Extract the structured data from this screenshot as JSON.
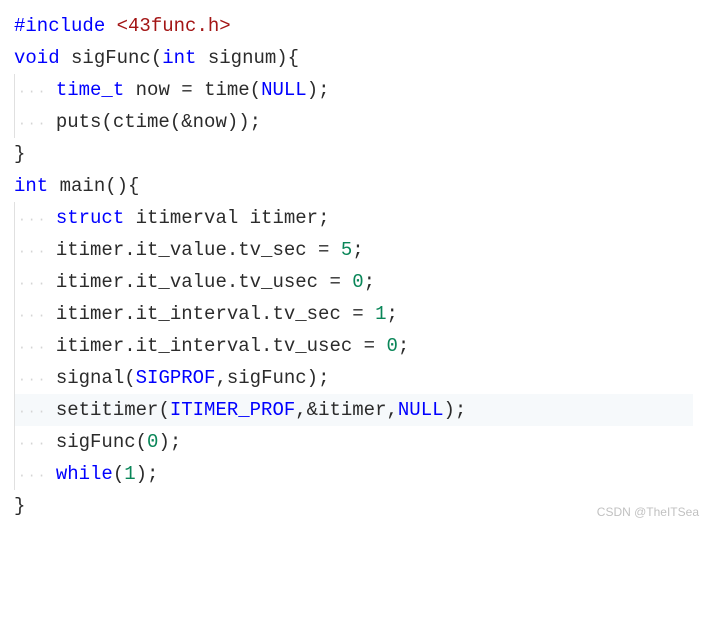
{
  "lines": [
    {
      "indent": 0,
      "tokens": [
        {
          "t": "#include ",
          "c": "pre"
        },
        {
          "t": "<43func.h>",
          "c": "inc"
        }
      ]
    },
    {
      "indent": 0,
      "tokens": [
        {
          "t": "void",
          "c": "kw"
        },
        {
          "t": " ",
          "c": "id"
        },
        {
          "t": "sigFunc",
          "c": "fn"
        },
        {
          "t": "(",
          "c": "op"
        },
        {
          "t": "int",
          "c": "kw"
        },
        {
          "t": " signum){",
          "c": "id"
        }
      ]
    },
    {
      "indent": 1,
      "tokens": [
        {
          "t": "time_t",
          "c": "type"
        },
        {
          "t": " now = ",
          "c": "id"
        },
        {
          "t": "time",
          "c": "fn"
        },
        {
          "t": "(",
          "c": "op"
        },
        {
          "t": "NULL",
          "c": "const"
        },
        {
          "t": ");",
          "c": "op"
        }
      ]
    },
    {
      "indent": 1,
      "tokens": [
        {
          "t": "puts",
          "c": "fn"
        },
        {
          "t": "(",
          "c": "op"
        },
        {
          "t": "ctime",
          "c": "fn"
        },
        {
          "t": "(&now));",
          "c": "op"
        }
      ]
    },
    {
      "indent": 0,
      "tokens": [
        {
          "t": "}",
          "c": "op"
        }
      ]
    },
    {
      "indent": 0,
      "tokens": [
        {
          "t": "int",
          "c": "kw"
        },
        {
          "t": " ",
          "c": "id"
        },
        {
          "t": "main",
          "c": "fn"
        },
        {
          "t": "(){",
          "c": "op"
        }
      ]
    },
    {
      "indent": 1,
      "tokens": [
        {
          "t": "struct",
          "c": "kw"
        },
        {
          "t": " itimerval itimer;",
          "c": "id"
        }
      ]
    },
    {
      "indent": 1,
      "tokens": [
        {
          "t": "itimer.it_value.tv_sec = ",
          "c": "id"
        },
        {
          "t": "5",
          "c": "num"
        },
        {
          "t": ";",
          "c": "op"
        }
      ]
    },
    {
      "indent": 1,
      "tokens": [
        {
          "t": "itimer.it_value.tv_usec = ",
          "c": "id"
        },
        {
          "t": "0",
          "c": "num"
        },
        {
          "t": ";",
          "c": "op"
        }
      ]
    },
    {
      "indent": 1,
      "tokens": [
        {
          "t": "itimer.it_interval.tv_sec = ",
          "c": "id"
        },
        {
          "t": "1",
          "c": "num"
        },
        {
          "t": ";",
          "c": "op"
        }
      ]
    },
    {
      "indent": 1,
      "tokens": [
        {
          "t": "itimer.it_interval.tv_usec = ",
          "c": "id"
        },
        {
          "t": "0",
          "c": "num"
        },
        {
          "t": ";",
          "c": "op"
        }
      ]
    },
    {
      "indent": 1,
      "tokens": [
        {
          "t": "signal",
          "c": "fn"
        },
        {
          "t": "(",
          "c": "op"
        },
        {
          "t": "SIGPROF",
          "c": "const"
        },
        {
          "t": ",sigFunc);",
          "c": "id"
        }
      ]
    },
    {
      "indent": 1,
      "highlight": true,
      "tokens": [
        {
          "t": "setitimer",
          "c": "fn"
        },
        {
          "t": "(",
          "c": "op"
        },
        {
          "t": "ITIMER_PROF",
          "c": "const"
        },
        {
          "t": ",&itimer,",
          "c": "id"
        },
        {
          "t": "NULL",
          "c": "const"
        },
        {
          "t": ");",
          "c": "op"
        }
      ]
    },
    {
      "indent": 1,
      "tokens": [
        {
          "t": "sigFunc",
          "c": "fn"
        },
        {
          "t": "(",
          "c": "op"
        },
        {
          "t": "0",
          "c": "num"
        },
        {
          "t": ");",
          "c": "op"
        }
      ]
    },
    {
      "indent": 1,
      "tokens": [
        {
          "t": "while",
          "c": "kw"
        },
        {
          "t": "(",
          "c": "op"
        },
        {
          "t": "1",
          "c": "num"
        },
        {
          "t": ");",
          "c": "op"
        }
      ]
    },
    {
      "indent": 0,
      "tokens": [
        {
          "t": "}",
          "c": "op"
        }
      ]
    }
  ],
  "watermark": "CSDN @TheITSea"
}
